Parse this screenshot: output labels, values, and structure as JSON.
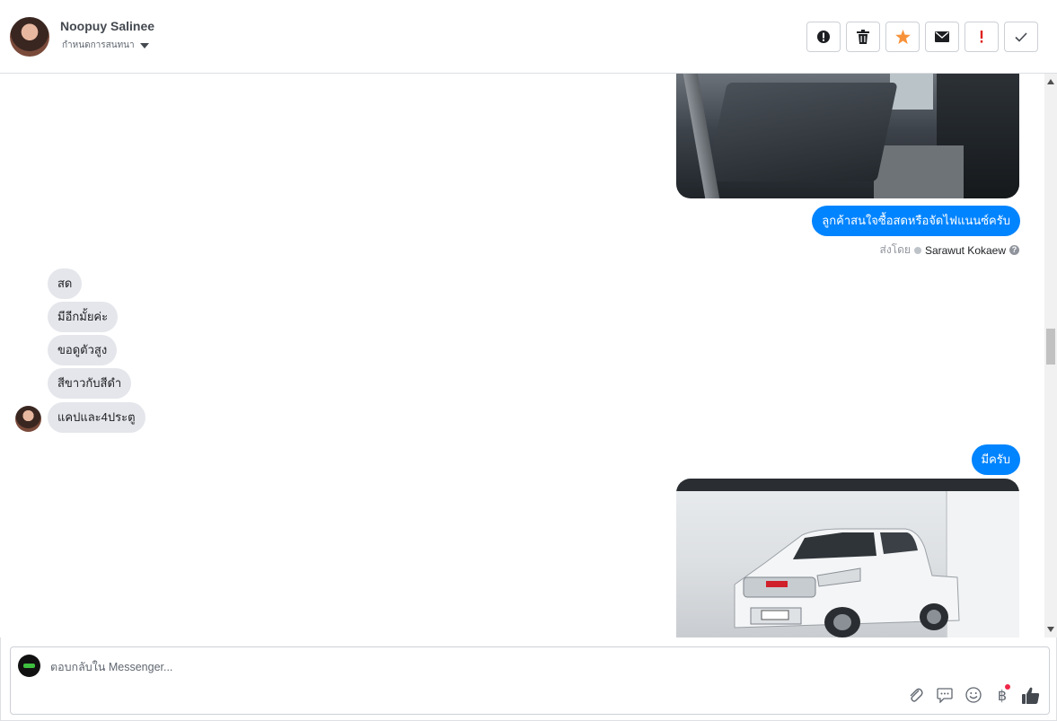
{
  "header": {
    "contact_name": "Noopuy Salinee",
    "assign_label": "กำหนดการสนทนา",
    "actions": [
      {
        "name": "mark-spam-button",
        "icon": "exclamation-circle-icon"
      },
      {
        "name": "delete-button",
        "icon": "trash-icon"
      },
      {
        "name": "star-button",
        "icon": "star-icon",
        "color": "#f7923a"
      },
      {
        "name": "mark-unread-button",
        "icon": "envelope-icon"
      },
      {
        "name": "follow-up-button",
        "icon": "exclamation-icon",
        "color": "#e02020"
      },
      {
        "name": "mark-done-button",
        "icon": "check-icon"
      }
    ]
  },
  "messages": {
    "outgoing_1": "ลูกค้าสนใจซื้อสดหรือจัดไฟแนนซ์ครับ",
    "sent_by_label": "ส่งโดย",
    "sent_by_name": "Sarawut Kokaew",
    "incoming": [
      "สด",
      "มีอีกมั้ยค่ะ",
      "ขอดูตัวสูง",
      "สีขาวกับสีดำ",
      "แคปและ4ประตู"
    ],
    "outgoing_2": "มีครับ",
    "bubble_color": "#0084ff"
  },
  "composer": {
    "placeholder": "ตอบกลับใน Messenger...",
    "tools": [
      "paperclip-icon",
      "saved-reply-icon",
      "emoji-icon",
      "baht-payment-icon",
      "thumbs-up-icon"
    ],
    "baht_symbol": "฿"
  }
}
